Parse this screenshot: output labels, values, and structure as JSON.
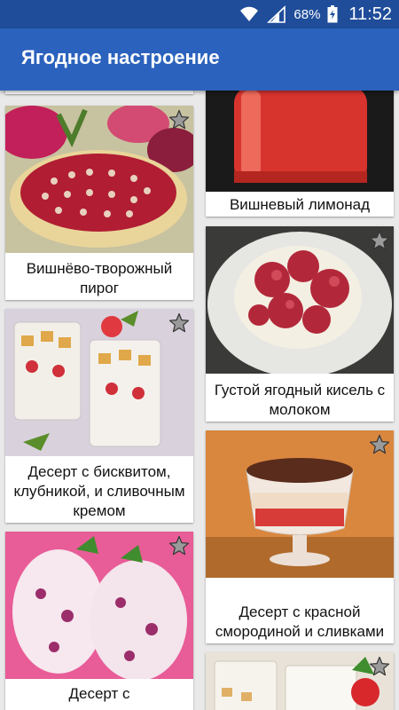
{
  "status_bar": {
    "battery": "68%",
    "time": "11:52"
  },
  "app_bar": {
    "title": "Ягодное настроение"
  },
  "recipes": {
    "left": [
      {
        "title": ""
      },
      {
        "title": "Вишнёво-творожный пирог"
      },
      {
        "title": "Десерт с бисквитом, клубникой, и сливочным кремом"
      },
      {
        "title": "Десерт с"
      }
    ],
    "right": [
      {
        "title": "Вишневый лимонад"
      },
      {
        "title": "Густой ягодный кисель с молоком"
      },
      {
        "title": "Десерт с красной смородиной и сливками"
      },
      {
        "title": ""
      }
    ]
  },
  "colors": {
    "status_bar": "#1f4d9a",
    "app_bar": "#2b62bd",
    "background": "#e9e9e9",
    "star_fill": "#9a9a9a"
  },
  "icons": {
    "favorite": "star-icon"
  }
}
